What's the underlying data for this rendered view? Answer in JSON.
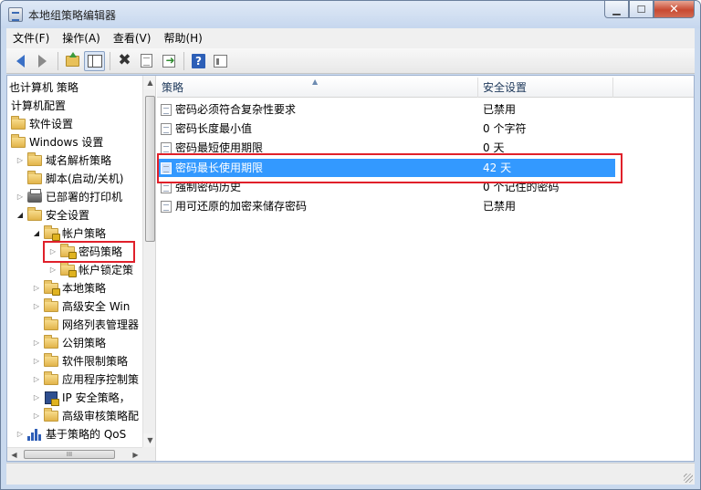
{
  "window": {
    "title": "本地组策略编辑器"
  },
  "menu": [
    "文件(F)",
    "操作(A)",
    "查看(V)",
    "帮助(H)"
  ],
  "toolbar": {
    "buttons": [
      "back-icon",
      "forward-icon",
      "up-folder-icon",
      "show-tree-icon",
      "delete-icon",
      "properties-icon",
      "export-icon",
      "help-icon",
      "show-pane-icon"
    ]
  },
  "tree": [
    {
      "label": "也计算机 策略",
      "level": 0,
      "icon": "none"
    },
    {
      "label": "计算机配置",
      "level": 0,
      "icon": "none"
    },
    {
      "label": "软件设置",
      "level": 0,
      "icon": "folder"
    },
    {
      "label": "Windows 设置",
      "level": 0,
      "icon": "folder"
    },
    {
      "label": "域名解析策略",
      "level": 1,
      "icon": "folder"
    },
    {
      "label": "脚本(启动/关机)",
      "level": 1,
      "icon": "folder"
    },
    {
      "label": "已部署的打印机",
      "level": 1,
      "icon": "printer"
    },
    {
      "label": "安全设置",
      "level": 1,
      "icon": "folder"
    },
    {
      "label": "帐户策略",
      "level": 2,
      "icon": "folder-lock"
    },
    {
      "label": "密码策略",
      "level": 3,
      "icon": "folder-lock"
    },
    {
      "label": "帐户锁定策",
      "level": 3,
      "icon": "folder-lock"
    },
    {
      "label": "本地策略",
      "level": 2,
      "icon": "folder-lock"
    },
    {
      "label": "高级安全 Win",
      "level": 2,
      "icon": "folder"
    },
    {
      "label": "网络列表管理器",
      "level": 2,
      "icon": "folder"
    },
    {
      "label": "公钥策略",
      "level": 2,
      "icon": "folder"
    },
    {
      "label": "软件限制策略",
      "level": 2,
      "icon": "folder"
    },
    {
      "label": "应用程序控制策",
      "level": 2,
      "icon": "folder"
    },
    {
      "label": "IP 安全策略，",
      "level": 2,
      "icon": "ipsec"
    },
    {
      "label": "高级审核策略配",
      "level": 2,
      "icon": "folder"
    },
    {
      "label": "基于策略的 QoS",
      "level": 1,
      "icon": "qos"
    }
  ],
  "list": {
    "headers": {
      "policy": "策略",
      "setting": "安全设置"
    },
    "rows": [
      {
        "policy": "密码必须符合复杂性要求",
        "setting": "已禁用"
      },
      {
        "policy": "密码长度最小值",
        "setting": "0 个字符"
      },
      {
        "policy": "密码最短使用期限",
        "setting": "0 天"
      },
      {
        "policy": "密码最长使用期限",
        "setting": "42 天"
      },
      {
        "policy": "强制密码历史",
        "setting": "0 个记住的密码"
      },
      {
        "policy": "用可还原的加密来储存密码",
        "setting": "已禁用"
      }
    ],
    "selected_index": 3
  },
  "highlight_color": "#e0202a",
  "selection_color": "#3399ff"
}
